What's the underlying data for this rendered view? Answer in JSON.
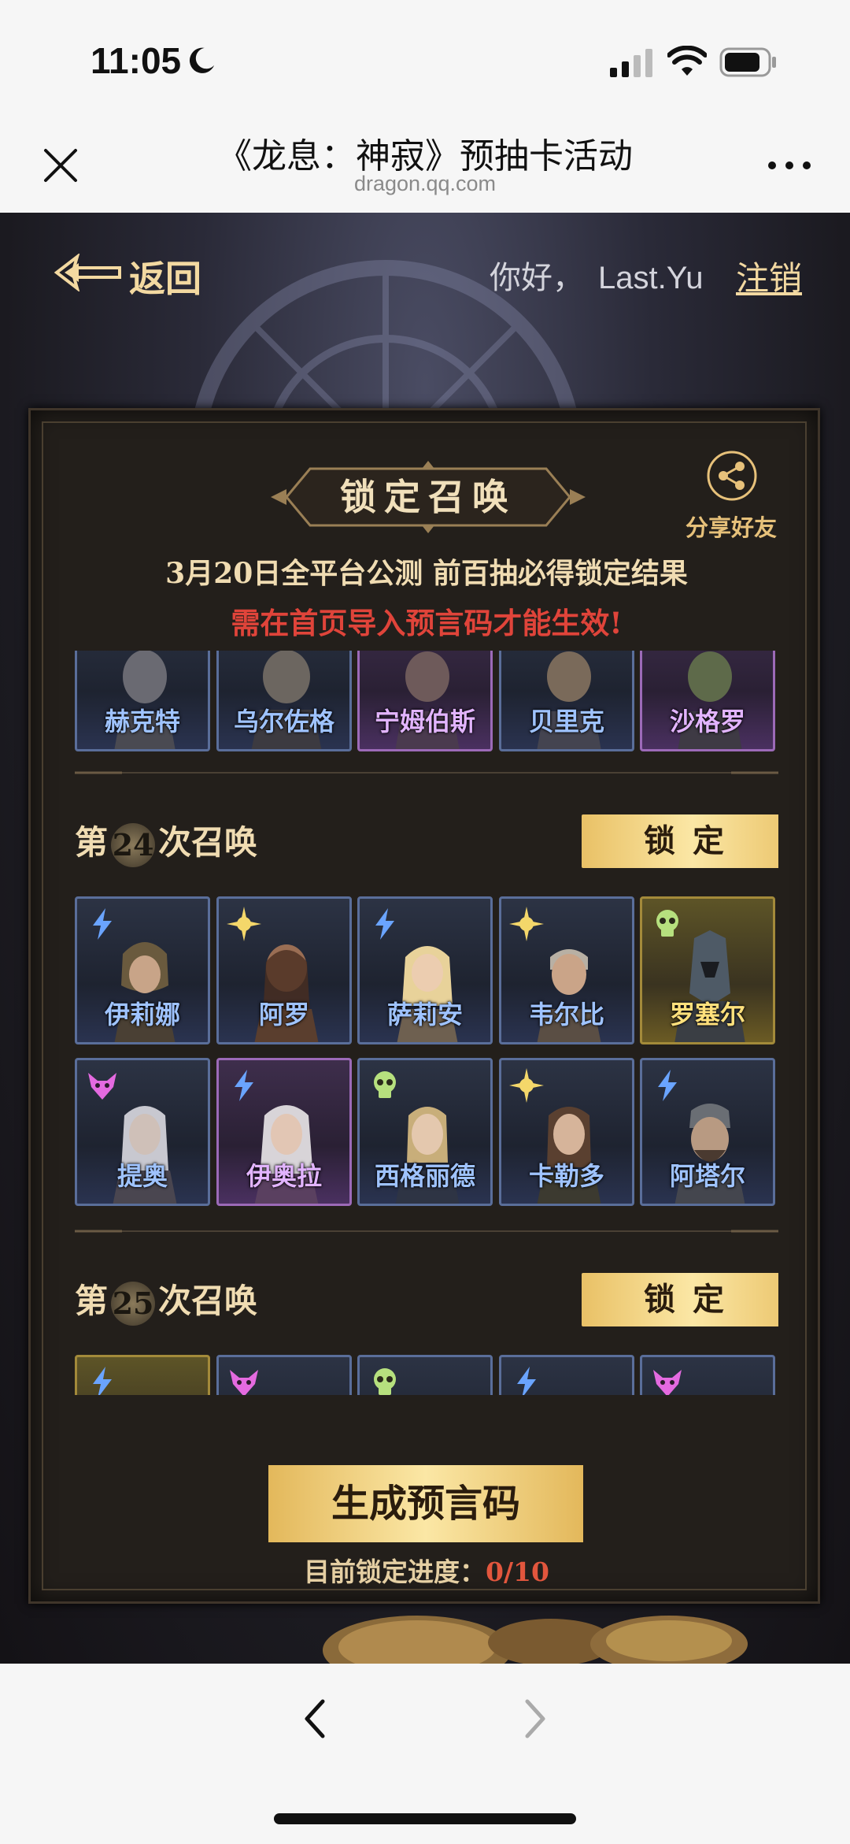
{
  "status_bar": {
    "time": "11:05"
  },
  "browser": {
    "title": "《龙息：神寂》预抽卡活动",
    "domain": "dragon.qq.com"
  },
  "header": {
    "back_label": "返回",
    "greeting": "你好，",
    "username": "Last.Yu",
    "logout_label": "注销"
  },
  "panel": {
    "title": "锁定召唤",
    "share_label": "分享好友",
    "notice": "3月20日全平台公测  前百抽必得锁定结果",
    "warning": "需在首页导入预言码才能生效!",
    "partial_row": [
      {
        "name": "赫克特",
        "rarity": "blue"
      },
      {
        "name": "乌尔佐格",
        "rarity": "blue"
      },
      {
        "name": "宁姆伯斯",
        "rarity": "purple"
      },
      {
        "name": "贝里克",
        "rarity": "blue"
      },
      {
        "name": "沙格罗",
        "rarity": "purple"
      }
    ],
    "rounds": [
      {
        "prefix": "第",
        "number": "24",
        "suffix": "次召唤",
        "lock_label": "锁定",
        "heroes": [
          {
            "name": "伊莉娜",
            "rarity": "blue",
            "element": "lightning-icon"
          },
          {
            "name": "阿罗",
            "rarity": "blue",
            "element": "sun-icon"
          },
          {
            "name": "萨莉安",
            "rarity": "blue",
            "element": "lightning-icon"
          },
          {
            "name": "韦尔比",
            "rarity": "blue",
            "element": "sun-icon"
          },
          {
            "name": "罗塞尔",
            "rarity": "gold",
            "element": "skull-icon"
          },
          {
            "name": "提奥",
            "rarity": "blue",
            "element": "demon-icon"
          },
          {
            "name": "伊奥拉",
            "rarity": "purple",
            "element": "lightning-icon"
          },
          {
            "name": "西格丽德",
            "rarity": "blue",
            "element": "skull-icon"
          },
          {
            "name": "卡勒多",
            "rarity": "blue",
            "element": "sun-icon"
          },
          {
            "name": "阿塔尔",
            "rarity": "blue",
            "element": "lightning-icon"
          }
        ]
      },
      {
        "prefix": "第",
        "number": "25",
        "suffix": "次召唤",
        "lock_label": "锁定",
        "heroes": [
          {
            "rarity": "gold",
            "element": "lightning-icon"
          },
          {
            "rarity": "blue",
            "element": "demon-icon"
          },
          {
            "rarity": "blue",
            "element": "skull-icon"
          },
          {
            "rarity": "blue",
            "element": "lightning-icon"
          },
          {
            "rarity": "blue",
            "element": "demon-icon"
          }
        ]
      }
    ],
    "generate_label": "生成预言码",
    "progress_label": "目前锁定进度：",
    "progress_value": "0/10"
  },
  "colors": {
    "accent_gold": "#f3d9a1",
    "warning_red": "#e0443a",
    "blue_rarity": "#5a6e9a",
    "purple_rarity": "#9c6ab8",
    "gold_rarity": "#a38a3a"
  }
}
